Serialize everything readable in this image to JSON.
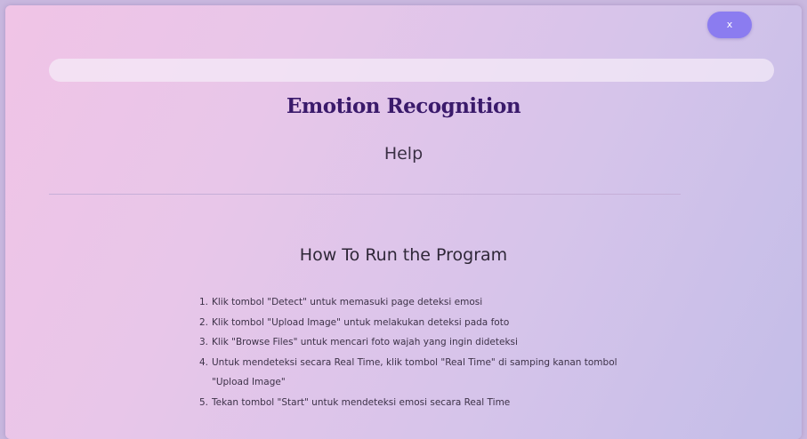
{
  "window": {
    "close_label": "x"
  },
  "header": {
    "app_title": "Emotion Recognition",
    "page_title": "Help"
  },
  "content": {
    "section_title": "How To Run the Program",
    "steps": [
      {
        "num": "1.",
        "text": "Klik tombol \"Detect\" untuk memasuki page deteksi emosi"
      },
      {
        "num": "2.",
        "text": "Klik tombol \"Upload Image\" untuk melakukan deteksi pada foto"
      },
      {
        "num": "3.",
        "text": "Klik \"Browse Files\" untuk mencari foto wajah yang ingin dideteksi"
      },
      {
        "num": "4.",
        "text": "Untuk mendeteksi secara Real Time, klik tombol \"Real Time\" di samping kanan tombol \"Upload Image\""
      },
      {
        "num": "5.",
        "text": "Tekan tombol \"Start\" untuk mendeteksi emosi secara Real Time"
      }
    ]
  },
  "colors": {
    "close_button": "#8b7cf0",
    "app_title": "#3a1a6b",
    "background_start": "#f0c4e6",
    "background_end": "#c3bde8"
  }
}
